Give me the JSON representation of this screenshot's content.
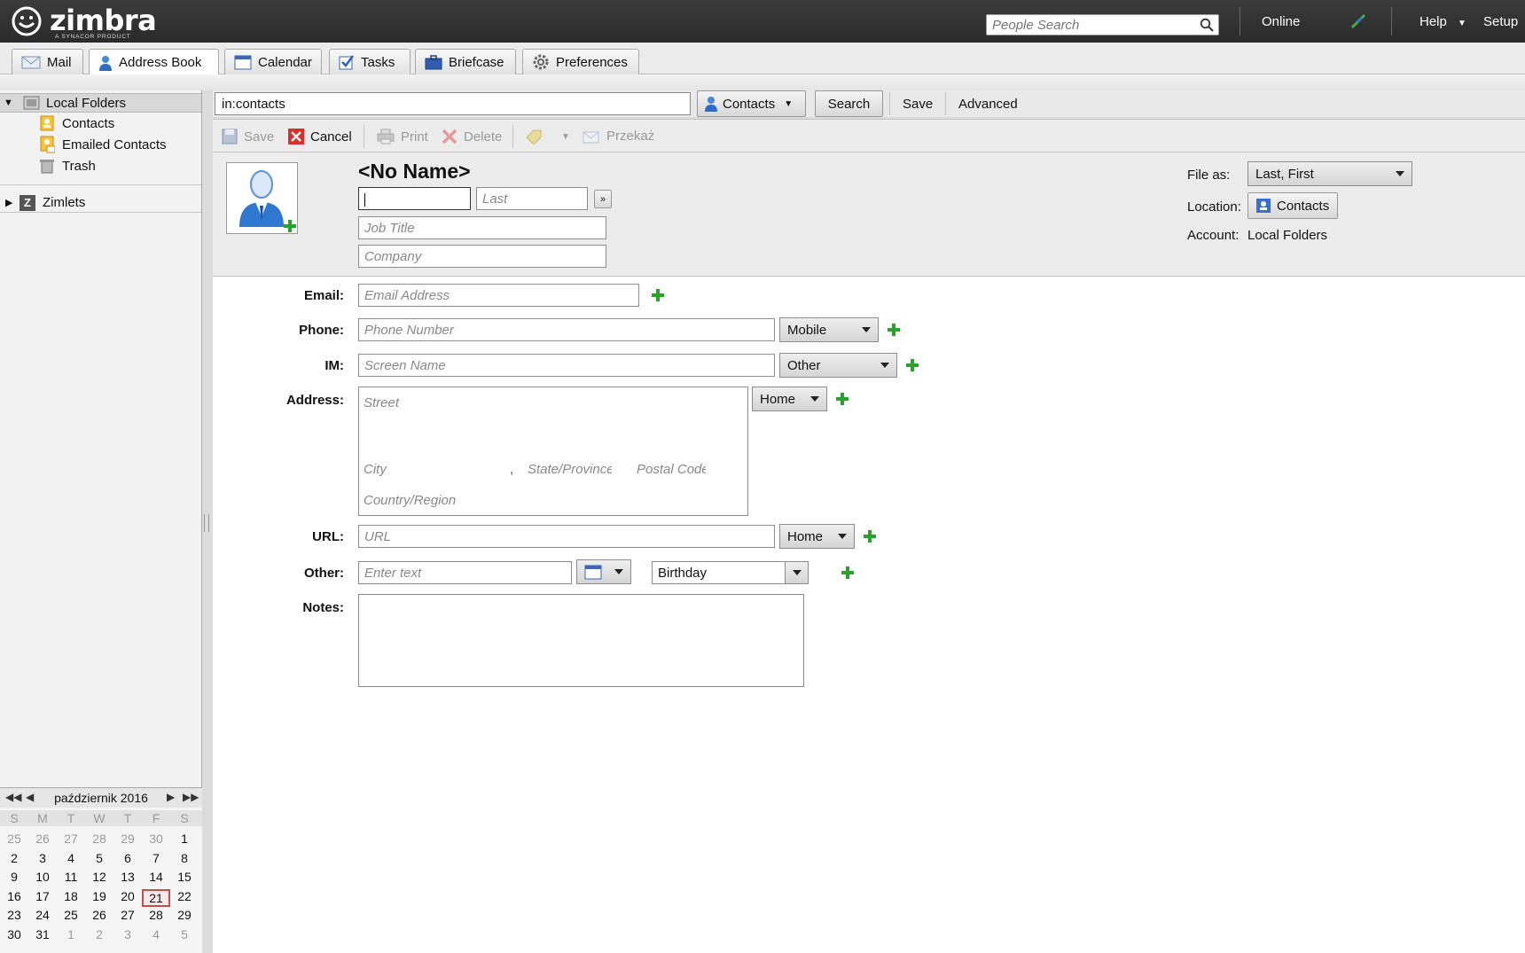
{
  "app": {
    "brand": "zimbra",
    "brand_sub": "A SYNACOR PRODUCT",
    "people_search_placeholder": "People Search",
    "status": "Online",
    "help": "Help",
    "setup": "Setup"
  },
  "tabs": [
    {
      "label": "Mail",
      "icon": "envelope-icon"
    },
    {
      "label": "Address Book",
      "icon": "contact-icon"
    },
    {
      "label": "Calendar",
      "icon": "calendar-icon"
    },
    {
      "label": "Tasks",
      "icon": "checkbox-icon"
    },
    {
      "label": "Briefcase",
      "icon": "briefcase-icon"
    },
    {
      "label": "Preferences",
      "icon": "gear-icon"
    }
  ],
  "sidebar": {
    "root": "Local Folders",
    "items": [
      "Contacts",
      "Emailed Contacts",
      "Trash"
    ],
    "zimlets": "Zimlets"
  },
  "calendar": {
    "month": "październik 2016",
    "dow": [
      "S",
      "M",
      "T",
      "W",
      "T",
      "F",
      "S"
    ],
    "weeks": [
      [
        "25",
        "26",
        "27",
        "28",
        "29",
        "30",
        "1"
      ],
      [
        "2",
        "3",
        "4",
        "5",
        "6",
        "7",
        "8"
      ],
      [
        "9",
        "10",
        "11",
        "12",
        "13",
        "14",
        "15"
      ],
      [
        "16",
        "17",
        "18",
        "19",
        "20",
        "21",
        "22"
      ],
      [
        "23",
        "24",
        "25",
        "26",
        "27",
        "28",
        "29"
      ],
      [
        "30",
        "31",
        "1",
        "2",
        "3",
        "4",
        "5"
      ]
    ],
    "today": "21"
  },
  "search": {
    "query": "in:contacts",
    "scope": "Contacts",
    "search_btn": "Search",
    "save_btn": "Save",
    "advanced_btn": "Advanced"
  },
  "toolbar": {
    "save": "Save",
    "cancel": "Cancel",
    "print": "Print",
    "delete": "Delete",
    "forward": "Przekaż"
  },
  "contact": {
    "name": "<No Name>",
    "first_placeholder": "",
    "last_placeholder": "Last",
    "more": "»",
    "job_title_placeholder": "Job Title",
    "company_placeholder": "Company",
    "file_as_label": "File as:",
    "file_as_value": "Last, First",
    "location_label": "Location:",
    "location_value": "Contacts",
    "account_label": "Account:",
    "account_value": "Local Folders"
  },
  "form": {
    "email_label": "Email:",
    "email_placeholder": "Email Address",
    "phone_label": "Phone:",
    "phone_placeholder": "Phone Number",
    "phone_type": "Mobile",
    "im_label": "IM:",
    "im_placeholder": "Screen Name",
    "im_type": "Other",
    "address_label": "Address:",
    "street_placeholder": "Street",
    "city_placeholder": "City",
    "comma": ",",
    "state_placeholder": "State/Province",
    "postal_placeholder": "Postal Code",
    "country_placeholder": "Country/Region",
    "address_type": "Home",
    "url_label": "URL:",
    "url_placeholder": "URL",
    "url_type": "Home",
    "other_label": "Other:",
    "other_placeholder": "Enter text",
    "other_type": "Birthday",
    "notes_label": "Notes:"
  },
  "colors": {
    "accent_green": "#2ca02c",
    "cancel_red": "#d9302b",
    "topbar": "#2f2f2f"
  }
}
